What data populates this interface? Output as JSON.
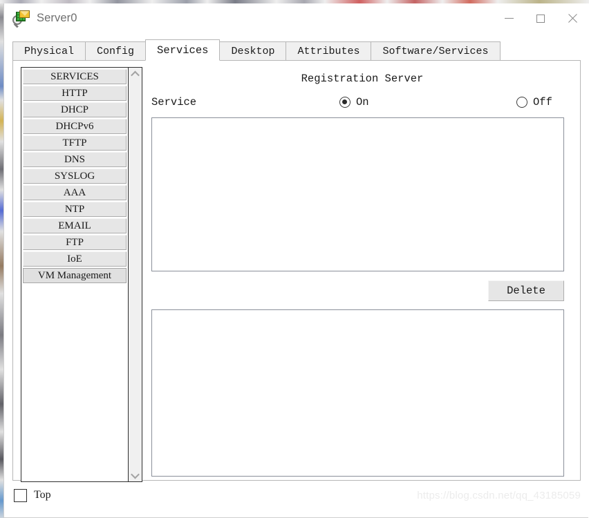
{
  "window": {
    "title": "Server0",
    "icon": "packet-tracer-server-icon",
    "controls": {
      "minimize": "minimize-icon",
      "maximize": "maximize-icon",
      "close": "close-icon"
    }
  },
  "tabs": [
    {
      "label": "Physical",
      "active": false
    },
    {
      "label": "Config",
      "active": false
    },
    {
      "label": "Services",
      "active": true
    },
    {
      "label": "Desktop",
      "active": false
    },
    {
      "label": "Attributes",
      "active": false
    },
    {
      "label": "Software/Services",
      "active": false
    }
  ],
  "sidebar": {
    "scrollbar": {
      "up": "chevron-up-icon",
      "down": "chevron-down-icon"
    },
    "items": [
      {
        "label": "SERVICES",
        "selected": false,
        "header": true
      },
      {
        "label": "HTTP",
        "selected": false,
        "header": false
      },
      {
        "label": "DHCP",
        "selected": false,
        "header": false
      },
      {
        "label": "DHCPv6",
        "selected": false,
        "header": false
      },
      {
        "label": "TFTP",
        "selected": false,
        "header": false
      },
      {
        "label": "DNS",
        "selected": false,
        "header": false
      },
      {
        "label": "SYSLOG",
        "selected": false,
        "header": false
      },
      {
        "label": "AAA",
        "selected": false,
        "header": false
      },
      {
        "label": "NTP",
        "selected": false,
        "header": false
      },
      {
        "label": "EMAIL",
        "selected": false,
        "header": false
      },
      {
        "label": "FTP",
        "selected": false,
        "header": false
      },
      {
        "label": "IoE",
        "selected": false,
        "header": false
      },
      {
        "label": "VM Management",
        "selected": true,
        "header": false
      }
    ]
  },
  "pane": {
    "title": "Registration Server",
    "service_label": "Service",
    "radio_on": {
      "label": "On",
      "checked": true
    },
    "radio_off": {
      "label": "Off",
      "checked": false
    },
    "top_list_items": [],
    "bottom_list_items": [],
    "delete_label": "Delete"
  },
  "footer": {
    "top_label": "Top",
    "top_checked": false,
    "watermark": "https://blog.csdn.net/qq_43185059"
  },
  "colors": {
    "button_face": "#e6e6e6",
    "panel_border": "#8a8f99",
    "title_text": "#6f6f6f",
    "watermark": "#ececec"
  }
}
